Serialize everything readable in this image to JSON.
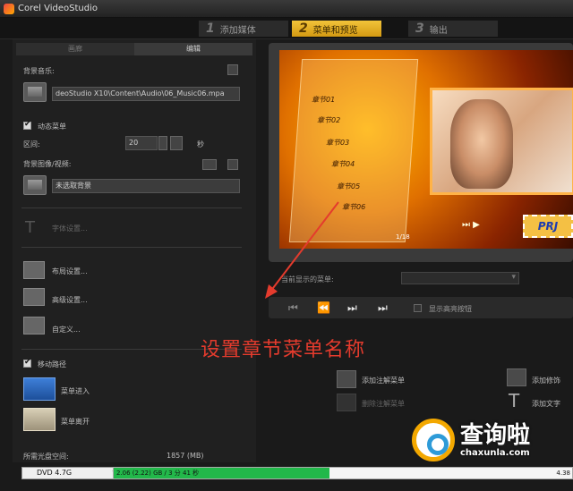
{
  "window": {
    "title": "Corel VideoStudio"
  },
  "steps": [
    {
      "num": "1",
      "label": "添加媒体"
    },
    {
      "num": "2",
      "label": "菜单和预览"
    },
    {
      "num": "3",
      "label": "输出"
    }
  ],
  "left": {
    "tabs": [
      "画廊",
      "编辑"
    ],
    "bg_music_label": "背景音乐:",
    "bg_music_path": "deoStudio X10\\Content\\Audio\\06_Music06.mpa",
    "motion_menu_label": "动态菜单",
    "duration_label": "区间:",
    "duration_value": "20",
    "duration_unit": "秒",
    "bg_image_label": "背景图像/视频:",
    "bg_image_value": "未选取背景",
    "font_settings": "字体设置...",
    "layout_settings": "布局设置...",
    "advanced_settings": "高级设置...",
    "customize": "自定义...",
    "motion_path_label": "移动路径",
    "menu_enter": "菜单进入",
    "menu_leave": "菜单离开",
    "space_label": "所需光盘空间:",
    "space_value": "1857 (MB)"
  },
  "preview": {
    "chapters": [
      "章节01",
      "章节02",
      "章节03",
      "章节04",
      "章节05",
      "章节06"
    ],
    "page_indicator": "1/18",
    "prj_label": "PRJ"
  },
  "controls": {
    "select_label": "当前显示的菜单:",
    "show_label": "显示高亮按钮"
  },
  "actions": {
    "add_sub_menu": "添加注解菜单",
    "remove_sub_menu": "删除注解菜单",
    "add_decoration": "添加修饰",
    "add_text": "添加文字"
  },
  "annotation": "设置章节菜单名称",
  "bottom": {
    "dvd_type": "DVD 4.7G",
    "progress_text": "2.06 (2.22) GB / 3 分 41 秒",
    "progress_end": "4.38",
    "progress_fraction": 0.47
  },
  "watermark": {
    "name": "查询啦",
    "url": "chaxunla.com"
  },
  "colors": {
    "accent": "#f2c33a",
    "annotation": "#e43b2d",
    "progress": "#22b84a"
  }
}
